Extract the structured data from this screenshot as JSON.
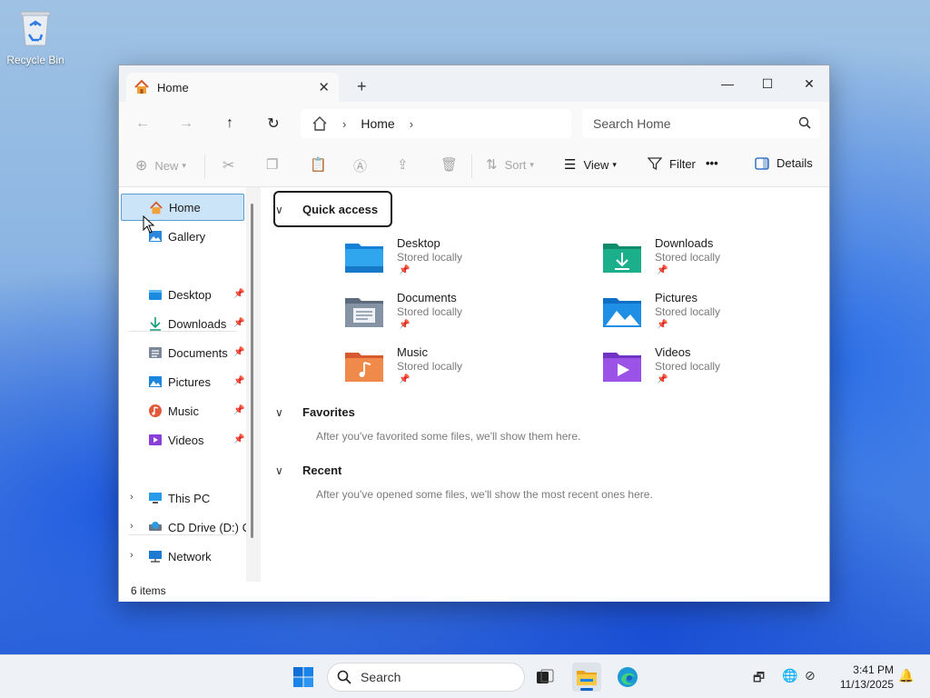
{
  "desktop": {
    "icons": [
      {
        "label": "Recycle Bin",
        "icon": "recycle-bin-icon"
      }
    ]
  },
  "window": {
    "tab": {
      "title": "Home",
      "icon": "home-icon",
      "close": "✕"
    },
    "new_tab": "+",
    "controls": {
      "minimize": "—",
      "maximize": "☐",
      "close": "✕"
    },
    "nav": {
      "back": "←",
      "forward": "→",
      "up": "↑",
      "refresh": "↻",
      "breadcrumb": {
        "icon": "home-icon",
        "segment": "Home",
        "sep": "›"
      },
      "search_placeholder": "Search Home"
    },
    "toolbar": {
      "new": "New",
      "sort": "Sort",
      "view": "View",
      "filter": "Filter",
      "more": "•••",
      "details": "Details"
    },
    "sidebar": {
      "top": [
        {
          "label": "Home",
          "icon": "home-icon",
          "active": true
        },
        {
          "label": "Gallery",
          "icon": "gallery-icon",
          "active": false
        }
      ],
      "pinned": [
        {
          "label": "Desktop",
          "icon": "desktop-folder-icon"
        },
        {
          "label": "Downloads",
          "icon": "downloads-icon"
        },
        {
          "label": "Documents",
          "icon": "documents-icon"
        },
        {
          "label": "Pictures",
          "icon": "pictures-icon"
        },
        {
          "label": "Music",
          "icon": "music-icon"
        },
        {
          "label": "Videos",
          "icon": "videos-icon"
        }
      ],
      "drives": [
        {
          "label": "This PC",
          "icon": "this-pc-icon"
        },
        {
          "label": "CD Drive (D:) CC",
          "icon": "cd-drive-icon"
        },
        {
          "label": "Network",
          "icon": "network-icon"
        }
      ]
    },
    "content": {
      "quick_access": {
        "title": "Quick access",
        "items": [
          {
            "name": "Desktop",
            "status": "Stored locally",
            "icon": "desktop-folder-icon"
          },
          {
            "name": "Downloads",
            "status": "Stored locally",
            "icon": "downloads-icon"
          },
          {
            "name": "Documents",
            "status": "Stored locally",
            "icon": "documents-icon"
          },
          {
            "name": "Pictures",
            "status": "Stored locally",
            "icon": "pictures-icon"
          },
          {
            "name": "Music",
            "status": "Stored locally",
            "icon": "music-icon"
          },
          {
            "name": "Videos",
            "status": "Stored locally",
            "icon": "videos-icon"
          }
        ]
      },
      "favorites": {
        "title": "Favorites",
        "message": "After you've favorited some files, we'll show them here."
      },
      "recent": {
        "title": "Recent",
        "message": "After you've opened some files, we'll show the most recent ones here."
      }
    },
    "status": "6 items"
  },
  "taskbar": {
    "search_label": "Search",
    "clock": {
      "time": "3:41 PM",
      "date": "11/13/2025"
    }
  },
  "colors": {
    "accent": "#0a64c8",
    "selection": "#cce4f7",
    "selection_border": "#5a9fd4"
  }
}
